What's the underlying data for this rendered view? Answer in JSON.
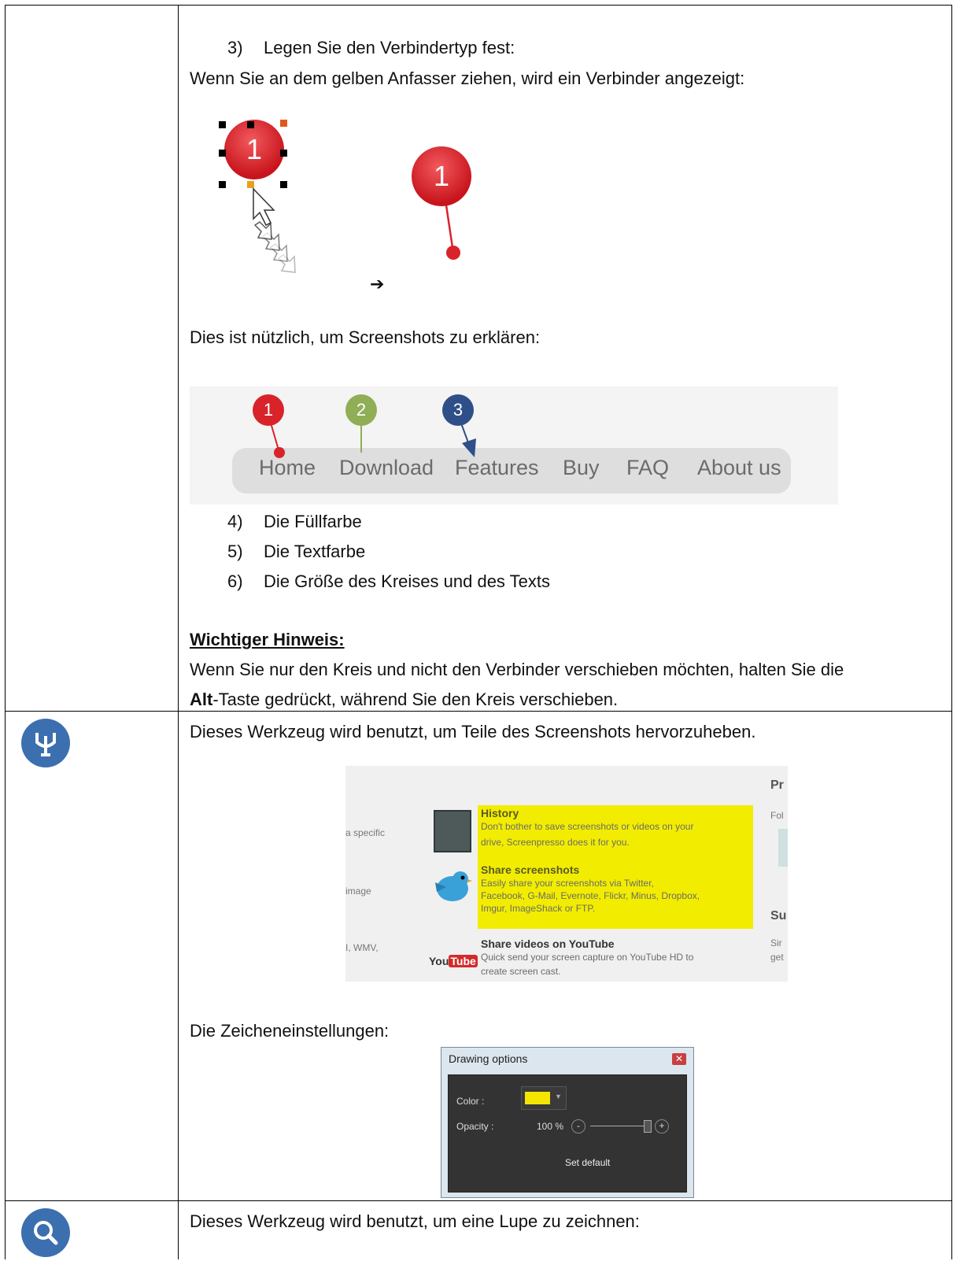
{
  "steps": {
    "step3_num": "3)",
    "step3_text": "Legen Sie den Verbindertyp fest:",
    "drag_line": "Wenn Sie an dem gelben Anfasser ziehen, wird ein Verbinder angezeigt:",
    "arrow": "➔",
    "useful_line": "Dies ist nützlich, um Screenshots zu erklären:",
    "step4_num": "4)",
    "step4_text": "Die Füllfarbe",
    "step5_num": "5)",
    "step5_text": "Die Textfarbe",
    "step6_num": "6)",
    "step6_text": "Die Größe des Kreises und des Texts",
    "note_title": "Wichtiger Hinweis:",
    "note_line1": "Wenn Sie nur den Kreis und nicht den Verbinder verschieben möchten, halten Sie die",
    "note_alt": "Alt",
    "note_line2_rest": "-Taste gedrückt, während Sie den Kreis verschieben."
  },
  "callout_example": {
    "badge_label": "1"
  },
  "nav_example": {
    "badges": [
      "1",
      "2",
      "3"
    ],
    "badge_colors": [
      "#d9232a",
      "#8fae55",
      "#2e4f87"
    ],
    "items": [
      "Home",
      "Download",
      "Features",
      "Buy",
      "FAQ",
      "About us"
    ]
  },
  "highlight_row": {
    "description": "Dieses Werkzeug wird benutzt, um Teile des Screenshots hervorzuheben.",
    "settings_label": "Die Zeicheneinstellungen:",
    "icon": "highlighter-icon",
    "accent": "#3c6faf",
    "screenshot": {
      "left_fragments": [
        "a specific",
        "image",
        "I, WMV,"
      ],
      "right_fragments": [
        "Pr",
        "Fol",
        "Su",
        "Sir",
        "get"
      ],
      "features": [
        {
          "title": "History",
          "body": [
            "Don't bother to save screenshots or videos on your",
            "drive, Screenpresso does it for you."
          ]
        },
        {
          "title": "Share screenshots",
          "body": [
            "Easily share your screenshots via Twitter,",
            "Facebook, G-Mail, Evernote, Flickr, Minus, Dropbox,",
            "Imgur, ImageShack or FTP."
          ]
        },
        {
          "title": "Share videos on YouTube",
          "body": [
            "Quick send your screen capture on YouTube HD to",
            "create screen cast."
          ]
        }
      ],
      "highlight_color": "#f2ed00",
      "youtube_logo": "You Tube"
    },
    "dialog": {
      "title": "Drawing options",
      "color_label": "Color :",
      "color_value": "#f5e600",
      "opacity_label": "Opacity :",
      "opacity_value": "100 %",
      "opacity_level": 1.0,
      "minus": "-",
      "plus": "+",
      "set_default": "Set default"
    }
  },
  "magnifier_row": {
    "description": "Dieses Werkzeug wird benutzt, um eine Lupe zu zeichnen:",
    "icon": "magnifier-icon"
  }
}
